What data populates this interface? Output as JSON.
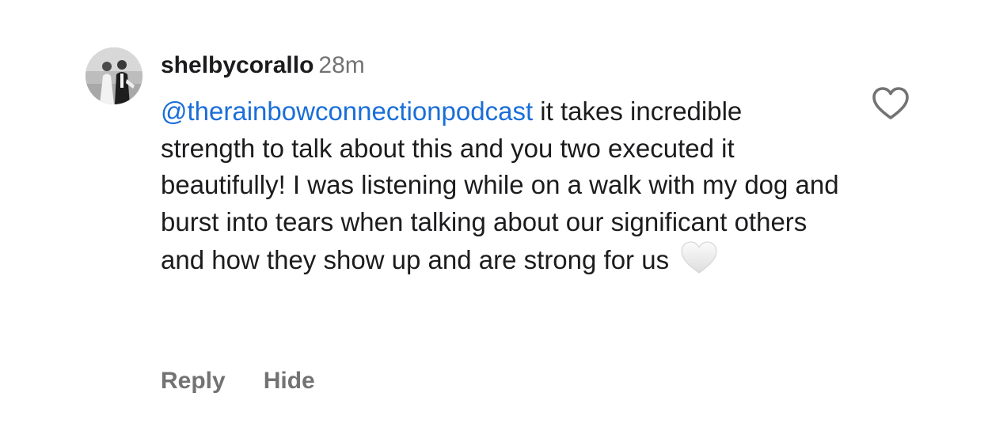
{
  "comment": {
    "username": "shelbycorallo",
    "timestamp": "28m",
    "mention": "@therainbowconnectionpodcast",
    "text": " it takes incredible strength to talk about this and you two executed it beautifully! I was listening while on a walk with my dog and burst into tears when talking about our significant others and how they show up and are strong for us",
    "emoji_icon": "white-heart-emoji",
    "liked": false
  },
  "actions": {
    "reply_label": "Reply",
    "hide_label": "Hide"
  },
  "icons": {
    "like": "heart-outline-icon",
    "avatar": "profile-photo"
  },
  "colors": {
    "text": "#1c1c1e",
    "secondary": "#737373",
    "mention": "#1a6ed8",
    "background": "#ffffff"
  }
}
